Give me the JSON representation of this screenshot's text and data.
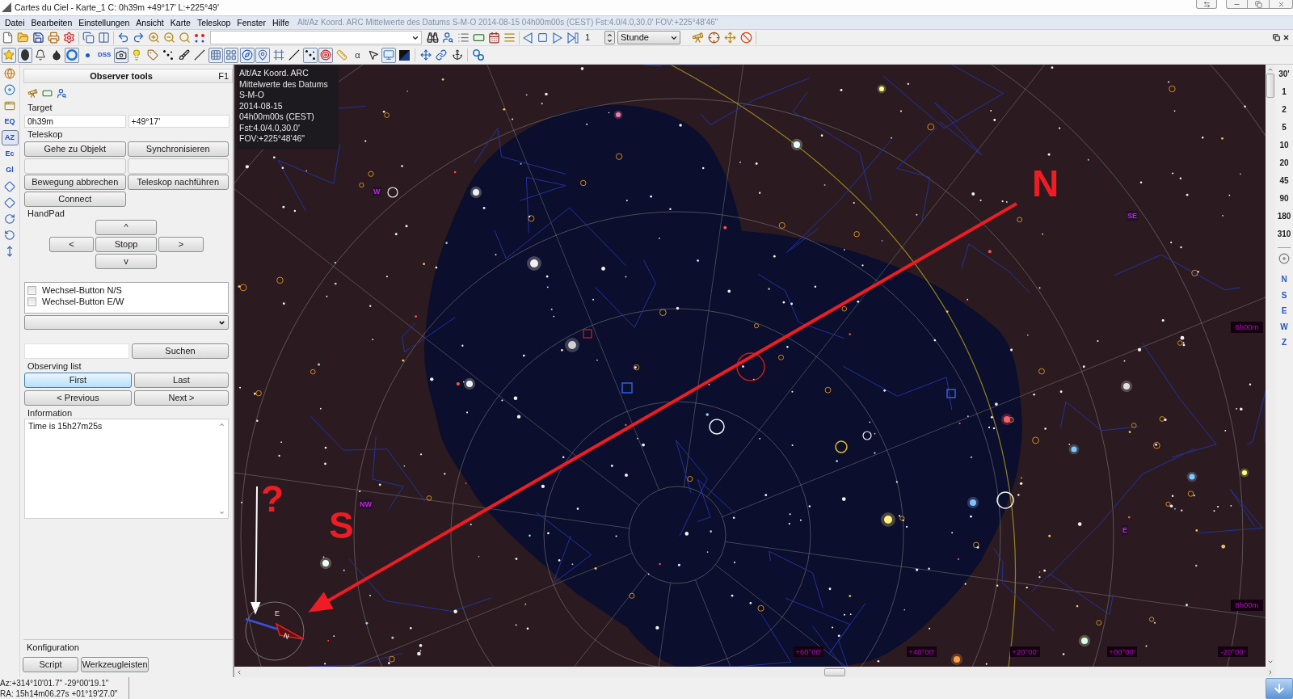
{
  "window": {
    "title": "Cartes du Ciel - Karte_1 C: 0h39m +49°17' L:+225°49'"
  },
  "menu": [
    "Datei",
    "Bearbeiten",
    "Einstellungen",
    "Ansicht",
    "Karte",
    "Teleskop",
    "Fenster",
    "Hilfe"
  ],
  "menu_status": "Alt/Az Koord. ARC Mittelwerte des Datums S-M-O 2014-08-15 04h00m00s (CEST) Fst:4.0/4.0,30.0' FOV:+225°48'46\"",
  "toolbar": {
    "step": "1",
    "unit": "Stunde"
  },
  "toolbar_2": [
    {
      "kind": "icon",
      "selected": true
    },
    {
      "kind": "icon",
      "selected": true
    },
    {
      "kind": "icon",
      "selected": false
    },
    {
      "kind": "icon",
      "selected": false
    },
    {
      "kind": "icon",
      "selected": true
    },
    {
      "kind": "icon",
      "selected": false
    },
    {
      "kind": "text",
      "label": "DSS",
      "selected": false
    },
    {
      "kind": "icon",
      "selected": true
    },
    {
      "kind": "icon",
      "selected": false
    },
    {
      "kind": "icon",
      "selected": false
    },
    {
      "kind": "icon",
      "selected": false
    },
    {
      "kind": "icon",
      "selected": false
    },
    {
      "kind": "icon",
      "selected": false
    },
    {
      "kind": "icon",
      "selected": true
    },
    {
      "kind": "icon",
      "selected": true
    },
    {
      "kind": "icon",
      "selected": true
    },
    {
      "kind": "icon",
      "selected": true
    },
    {
      "kind": "icon",
      "selected": false
    },
    {
      "kind": "icon",
      "selected": false
    },
    {
      "kind": "icon",
      "selected": true
    },
    {
      "kind": "icon",
      "selected": true
    },
    {
      "kind": "icon",
      "selected": false
    },
    {
      "kind": "text",
      "label": "α",
      "selected": false
    },
    {
      "kind": "icon",
      "selected": false
    },
    {
      "kind": "icon",
      "selected": true
    },
    {
      "kind": "icon",
      "selected": false
    },
    {
      "kind": "icon",
      "selected": false
    },
    {
      "kind": "icon",
      "selected": false
    },
    {
      "kind": "icon",
      "selected": false
    },
    {
      "kind": "icon",
      "selected": false
    }
  ],
  "view_strip": [
    {
      "kind": "icon",
      "selected": false
    },
    {
      "kind": "icon",
      "selected": false
    },
    {
      "kind": "icon",
      "selected": false
    },
    {
      "kind": "text",
      "label": "EQ",
      "selected": false
    },
    {
      "kind": "text",
      "label": "AZ",
      "selected": true
    },
    {
      "kind": "text",
      "label": "Ec",
      "selected": false
    },
    {
      "kind": "text",
      "label": "Gl",
      "selected": false
    },
    {
      "kind": "icon",
      "selected": false
    },
    {
      "kind": "icon",
      "selected": false
    },
    {
      "kind": "icon",
      "selected": false
    },
    {
      "kind": "icon",
      "selected": false
    },
    {
      "kind": "icon",
      "selected": false
    }
  ],
  "observer_tools": {
    "title": "Observer tools",
    "shortcut": "F1",
    "target": {
      "label": "Target",
      "ra": "0h39m",
      "dec": "+49°17'"
    },
    "telescope": {
      "label": "Teleskop",
      "buttons": [
        "Gehe zu Objekt",
        "Synchronisieren",
        "Bewegung abbrechen",
        "Teleskop nachführen",
        "Connect"
      ]
    },
    "handpad": {
      "label": "HandPad",
      "up": "^",
      "left": "<",
      "stop": "Stopp",
      "right": ">",
      "down": "v"
    },
    "options": [
      {
        "label": "Wechsel-Button N/S",
        "checked": false
      },
      {
        "label": "Wechsel-Button E/W",
        "checked": false
      }
    ],
    "search": {
      "button": "Suchen"
    },
    "observing_list": {
      "label": "Observing list",
      "buttons": [
        {
          "label": "First",
          "selected": true
        },
        {
          "label": "Last",
          "selected": false
        },
        {
          "label": "< Previous",
          "selected": false
        },
        {
          "label": "Next >",
          "selected": false
        }
      ]
    },
    "information": {
      "label": "Information",
      "text": "Time is 15h27m25s"
    },
    "configuration": {
      "label": "Konfiguration",
      "buttons": [
        "Script",
        "Werkzeugleisten"
      ]
    }
  },
  "chart": {
    "info": [
      "Alt/Az Koord. ARC",
      "Mittelwerte des Datums",
      "S-M-O",
      "2014-08-15",
      "04h00m00s (CEST)",
      "Fst:4.0/4.0,30.0'",
      "FOV:+225°48'46\""
    ],
    "horizon_labels": [
      "W",
      "SE",
      "NW",
      "E"
    ],
    "ra_labels": [
      "6h00m",
      "8h00m"
    ],
    "dec_labels": [
      "+60°00'",
      "+40°00'",
      "+20°00'",
      "+00°00'",
      "-20°00'"
    ],
    "compass": [
      "E",
      "N"
    ],
    "annotations": [
      "N",
      "S",
      "?"
    ]
  },
  "scale": [
    "30'",
    "1",
    "2",
    "5",
    "10",
    "20",
    "45",
    "90",
    "180",
    "310"
  ],
  "directions": [
    "N",
    "S",
    "E",
    "W",
    "Z"
  ],
  "status_bar": [
    "Az:+314°10'01.7\" -29°00'19.1\"",
    "RA: 15h14m06.27s +01°19'27.0\""
  ]
}
